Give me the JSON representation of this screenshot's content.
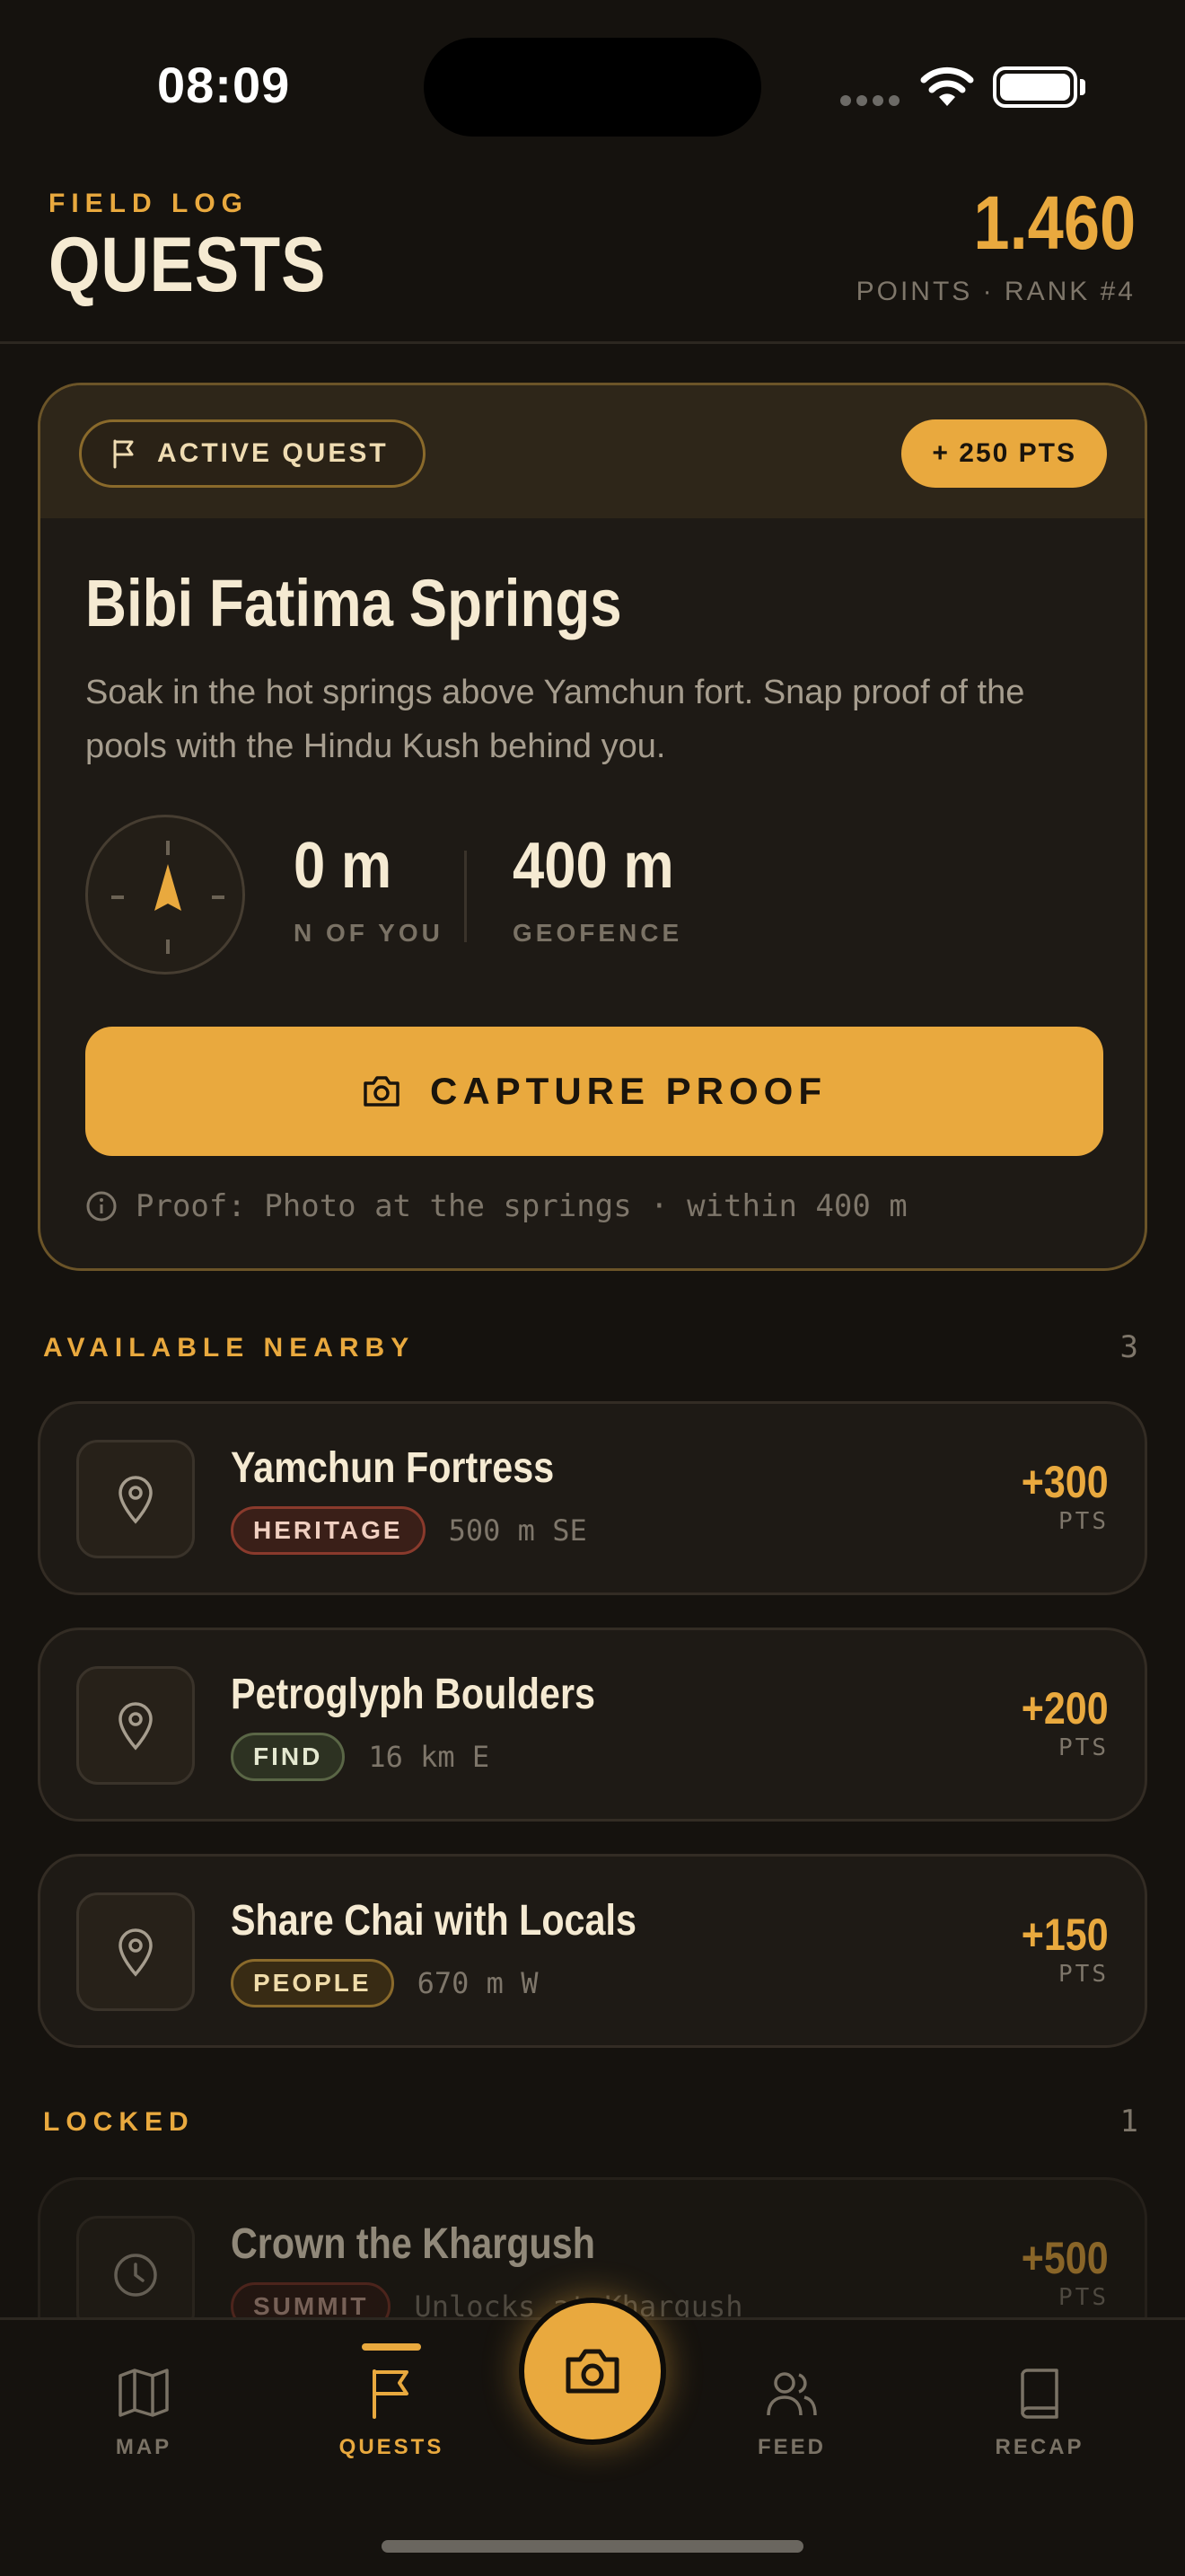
{
  "status_bar": {
    "time": "08:09"
  },
  "header": {
    "eyebrow": "FIELD LOG",
    "title": "QUESTS",
    "points": "1.460",
    "points_sub": "POINTS · RANK #4"
  },
  "active_quest": {
    "chip_label": "ACTIVE QUEST",
    "reward": "+ 250 PTS",
    "title": "Bibi Fatima Springs",
    "description": "Soak in the hot springs above Yamchun fort. Snap proof of the pools with the Hindu Kush behind you.",
    "distance_value": "0 m",
    "distance_label": "N OF YOU",
    "geofence_value": "400 m",
    "geofence_label": "GEOFENCE",
    "capture_label": "CAPTURE PROOF",
    "proof_note": "Proof: Photo at the springs · within 400 m"
  },
  "nearby": {
    "label": "AVAILABLE NEARBY",
    "count": "3",
    "items": [
      {
        "name": "Yamchun Fortress",
        "tag": "HERITAGE",
        "distance": "500 m SE",
        "points": "+300",
        "unit": "PTS"
      },
      {
        "name": "Petroglyph Boulders",
        "tag": "FIND",
        "distance": "16 km E",
        "points": "+200",
        "unit": "PTS"
      },
      {
        "name": "Share Chai with Locals",
        "tag": "PEOPLE",
        "distance": "670 m W",
        "points": "+150",
        "unit": "PTS"
      }
    ]
  },
  "locked": {
    "label": "LOCKED",
    "count": "1",
    "items": [
      {
        "name": "Crown the Khargush",
        "tag": "SUMMIT",
        "distance": "Unlocks at Khargush",
        "points": "+500",
        "unit": "PTS"
      }
    ]
  },
  "tabbar": {
    "map": "MAP",
    "quests": "QUESTS",
    "feed": "FEED",
    "recap": "RECAP"
  },
  "colors": {
    "accent": "#e9a93e",
    "background": "#15120e",
    "card": "#1e1a15"
  },
  "icons": [
    "flag-icon",
    "compass-icon",
    "camera-icon",
    "info-icon",
    "map-pin-icon",
    "clock-icon",
    "map-icon",
    "people-icon",
    "book-icon"
  ]
}
